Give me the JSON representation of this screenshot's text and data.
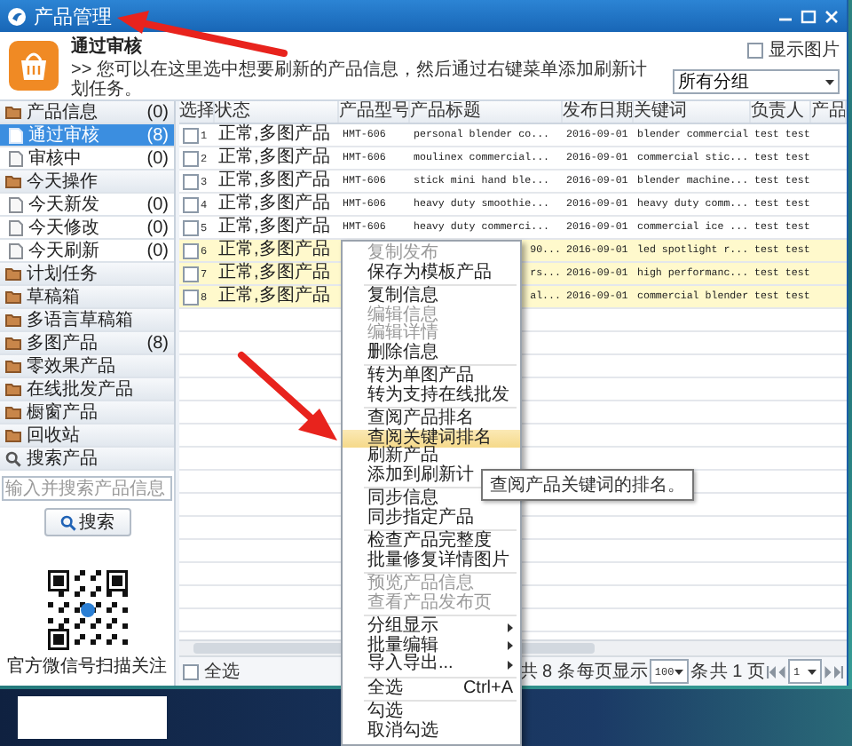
{
  "window": {
    "title": "产品管理"
  },
  "header": {
    "title": "通过审核",
    "hint": ">> 您可以在这里选中想要刷新的产品信息，然后通过右键菜单添加刷新计划任务。",
    "show_images": {
      "label": "显示图片",
      "checked": false
    },
    "group_select": {
      "value": "所有分组"
    }
  },
  "sidebar": {
    "items": [
      {
        "kind": "group",
        "label": "产品信息",
        "count": "(0)",
        "selected": false
      },
      {
        "kind": "item",
        "label": "通过审核",
        "count": "(8)",
        "selected": true
      },
      {
        "kind": "item",
        "label": "审核中",
        "count": "(0)",
        "selected": false
      },
      {
        "kind": "group",
        "label": "今天操作",
        "selected": false
      },
      {
        "kind": "item",
        "label": "今天新发",
        "count": "(0)",
        "selected": false
      },
      {
        "kind": "item",
        "label": "今天修改",
        "count": "(0)",
        "selected": false
      },
      {
        "kind": "item",
        "label": "今天刷新",
        "count": "(0)",
        "selected": false
      },
      {
        "kind": "group",
        "label": "计划任务",
        "selected": false
      },
      {
        "kind": "group",
        "label": "草稿箱",
        "selected": false
      },
      {
        "kind": "group",
        "label": "多语言草稿箱",
        "selected": false
      },
      {
        "kind": "group",
        "label": "多图产品",
        "count": "(8)",
        "selected": false
      },
      {
        "kind": "group",
        "label": "零效果产品",
        "selected": false
      },
      {
        "kind": "group",
        "label": "在线批发产品",
        "selected": false
      },
      {
        "kind": "group",
        "label": "橱窗产品",
        "selected": false
      },
      {
        "kind": "group",
        "label": "回收站",
        "selected": false
      },
      {
        "kind": "search",
        "label": "搜索产品",
        "selected": false
      }
    ],
    "search": {
      "placeholder": "输入并搜索产品信息",
      "button": "搜索"
    },
    "qr_caption": "官方微信号扫描关注"
  },
  "table": {
    "columns": [
      "选择",
      "状态",
      "产品型号",
      "产品标题",
      "发布日期",
      "关键词",
      "负责人",
      "产品"
    ],
    "rows": [
      {
        "index": "1",
        "checked": false,
        "selected": false,
        "status": "正常,多图产品",
        "model": "HMT-606",
        "title": "personal blender co...",
        "date": "2016-09-01",
        "keyword": "blender commercial",
        "owner": "test test"
      },
      {
        "index": "2",
        "checked": false,
        "selected": false,
        "status": "正常,多图产品",
        "model": "HMT-606",
        "title": "moulinex commercial...",
        "date": "2016-09-01",
        "keyword": "commercial stic...",
        "owner": "test test"
      },
      {
        "index": "3",
        "checked": false,
        "selected": false,
        "status": "正常,多图产品",
        "model": "HMT-606",
        "title": "stick mini hand ble...",
        "date": "2016-09-01",
        "keyword": "blender machine...",
        "owner": "test test"
      },
      {
        "index": "4",
        "checked": false,
        "selected": false,
        "status": "正常,多图产品",
        "model": "HMT-606",
        "title": "heavy duty smoothie...",
        "date": "2016-09-01",
        "keyword": "heavy duty comm...",
        "owner": "test test"
      },
      {
        "index": "5",
        "checked": false,
        "selected": false,
        "status": "正常,多图产品",
        "model": "HMT-606",
        "title": "heavy duty commerci...",
        "date": "2016-09-01",
        "keyword": "commercial ice ...",
        "owner": "test test"
      },
      {
        "index": "6",
        "checked": false,
        "selected": true,
        "status": "正常,多图产品",
        "title": "90...",
        "date": "2016-09-01",
        "keyword": "led spotlight r...",
        "owner": "test test"
      },
      {
        "index": "7",
        "checked": false,
        "selected": true,
        "status": "正常,多图产品",
        "title": "rs...",
        "date": "2016-09-01",
        "keyword": "high performanc...",
        "owner": "test test"
      },
      {
        "index": "8",
        "checked": false,
        "selected": true,
        "status": "正常,多图产品",
        "title": "al...",
        "date": "2016-09-01",
        "keyword": "commercial blender",
        "owner": "test test"
      }
    ]
  },
  "footer": {
    "select_all": {
      "label": "全选",
      "checked": false
    },
    "pager": {
      "total": "共 8 条",
      "per_page_label": "每页显示",
      "per_page": "100",
      "unit": "条",
      "pages": "共 1 页",
      "page": "1"
    }
  },
  "context_menu": {
    "tooltip": "查阅产品关键词的排名。",
    "groups": [
      [
        {
          "label": "复制发布",
          "disabled": true,
          "selected": false,
          "submenu": false
        },
        {
          "label": "保存为模板产品",
          "disabled": false,
          "selected": false,
          "submenu": false
        }
      ],
      [
        {
          "label": "复制信息",
          "disabled": false,
          "selected": false,
          "submenu": false
        },
        {
          "label": "编辑信息",
          "disabled": true,
          "selected": false,
          "submenu": false
        },
        {
          "label": "编辑详情",
          "disabled": true,
          "selected": false,
          "submenu": false
        },
        {
          "label": "删除信息",
          "disabled": false,
          "selected": false,
          "submenu": false
        }
      ],
      [
        {
          "label": "转为单图产品",
          "disabled": false,
          "selected": false,
          "submenu": false
        },
        {
          "label": "转为支持在线批发",
          "disabled": false,
          "selected": false,
          "submenu": false
        }
      ],
      [
        {
          "label": "查阅产品排名",
          "disabled": false,
          "selected": false,
          "submenu": false
        },
        {
          "label": "查阅关键词排名",
          "disabled": false,
          "selected": true,
          "submenu": false
        },
        {
          "label": "刷新产品",
          "disabled": false,
          "selected": false,
          "submenu": false
        },
        {
          "label": "添加到刷新计",
          "disabled": false,
          "selected": false
        }
      ],
      [
        {
          "label": "同步信息",
          "disabled": false,
          "selected": false,
          "submenu": false
        },
        {
          "label": "同步指定产品",
          "disabled": false,
          "selected": false,
          "submenu": false
        }
      ],
      [
        {
          "label": "检查产品完整度",
          "disabled": false,
          "selected": false,
          "submenu": false
        },
        {
          "label": "批量修复详情图片",
          "disabled": false,
          "selected": false,
          "submenu": false
        }
      ],
      [
        {
          "label": "预览产品信息",
          "disabled": true,
          "selected": false,
          "submenu": false
        },
        {
          "label": "查看产品发布页",
          "disabled": true,
          "selected": false,
          "submenu": false
        }
      ],
      [
        {
          "label": "分组显示",
          "disabled": false,
          "selected": false,
          "submenu": true
        },
        {
          "label": "批量编辑",
          "disabled": false,
          "selected": false,
          "submenu": true
        },
        {
          "label": "导入导出...",
          "disabled": false,
          "selected": false,
          "submenu": true
        }
      ],
      [
        {
          "label": "全选",
          "shortcut": "Ctrl+A",
          "disabled": false,
          "selected": false,
          "submenu": false
        }
      ],
      [
        {
          "label": "勾选",
          "disabled": false,
          "selected": false,
          "submenu": false
        },
        {
          "label": "取消勾选",
          "disabled": false,
          "selected": false,
          "submenu": false
        }
      ]
    ]
  }
}
